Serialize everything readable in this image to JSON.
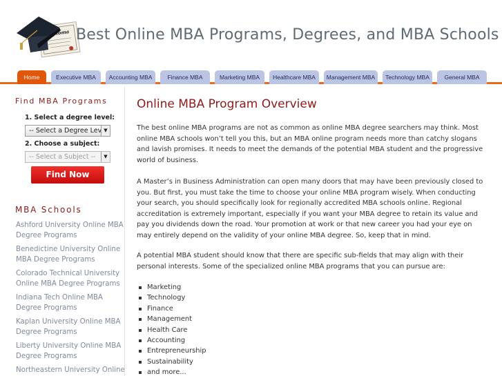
{
  "header": {
    "site_title": "Best Online MBA Programs, Degrees, and MBA Schools",
    "logo_text": "Diploma"
  },
  "nav": {
    "tabs": [
      {
        "label": "Home",
        "active": true
      },
      {
        "label": "Executive MBA",
        "active": false
      },
      {
        "label": "Accounting MBA",
        "active": false
      },
      {
        "label": "Finance MBA",
        "active": false
      },
      {
        "label": "Marketing MBA",
        "active": false
      },
      {
        "label": "Healthcare MBA",
        "active": false
      },
      {
        "label": "Management MBA",
        "active": false
      },
      {
        "label": "Technology MBA",
        "active": false
      },
      {
        "label": "General MBA",
        "active": false
      }
    ],
    "active_color": "#e2560a",
    "tab_color": "#bcc4e3"
  },
  "sidebar": {
    "find_heading": "Find MBA Programs",
    "step1_label": "1. Select a degree level:",
    "degree_select": "-- Select a Degree Level --",
    "step2_label": "2. Choose a subject:",
    "subject_select": "-- Select a Subject --",
    "find_button": "Find Now",
    "schools_heading": "MBA Schools",
    "schools": [
      "Ashford University Online MBA Degree Programs",
      "Benedictine University Online MBA Degree Programs",
      "Colorado Technical University Online MBA Degree Programs",
      "Indiana Tech Online MBA Degree Programs",
      "Kaplan University Online MBA Degree Programs",
      "Liberty University Online MBA Degree Programs",
      "Northeastern University Online MBA Degree Programs"
    ]
  },
  "main": {
    "title": "Online MBA Program Overview",
    "paragraphs": [
      "The best online MBA programs are not as common as online MBA degree searchers may think. Most online MBA schools won’t tell you this, but an MBA online program needs more than catchy slogans and lavish promises. It needs to meet the demands of the potential MBA student and the progressive world of business.",
      "A Master’s in Business Administration can open many doors that may have been previously closed to you. But first, you must take the time to choose your online MBA program wisely. When conducting your search, you should specifically look for regionally accredited MBA schools online. Regional accreditation is extremely important, especially if you want your MBA degree to retain its value and pay you dividends down the road. Your promotion at work or that new career you had your eye on may entirely depend on the validity of your online MBA degree. So, keep that in mind.",
      "A potential MBA student should know that there are specific sub-fields that may align with their personal interests. Some of the specialized online MBA programs that you can pursue are:"
    ],
    "specializations": [
      "Marketing",
      "Technology",
      "Finance",
      "Management",
      "Health Care",
      "Accounting",
      "Entrepreneurship",
      "Sustainability",
      "and more..."
    ]
  }
}
